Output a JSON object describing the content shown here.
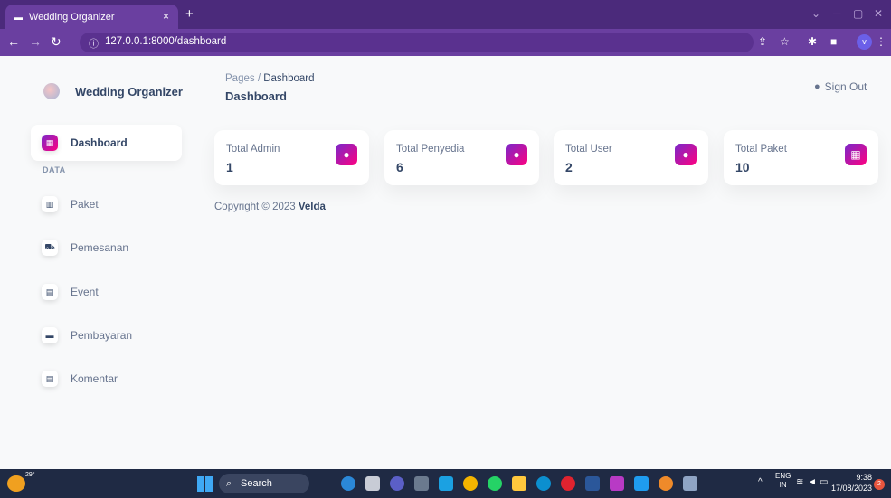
{
  "browser": {
    "tab_title": "Wedding Organizer",
    "tab_close": "×",
    "new_tab": "+",
    "url": "127.0.0.1:8000/dashboard",
    "profile_initial": "v"
  },
  "sidebar": {
    "brand": "Wedding Organizer",
    "active_item": "Dashboard",
    "section": "DATA",
    "items": [
      {
        "label": "Paket",
        "icon": "shop-icon"
      },
      {
        "label": "Pemesanan",
        "icon": "cart-icon"
      },
      {
        "label": "Event",
        "icon": "calendar-icon"
      },
      {
        "label": "Pembayaran",
        "icon": "card-icon"
      },
      {
        "label": "Komentar",
        "icon": "calendar-icon"
      }
    ]
  },
  "header": {
    "breadcrumb_root": "Pages",
    "breadcrumb_sep": "/",
    "breadcrumb_current": "Dashboard",
    "title": "Dashboard",
    "signout": "Sign Out"
  },
  "cards": [
    {
      "label": "Total Admin",
      "value": "1",
      "icon": "user-icon"
    },
    {
      "label": "Total Penyedia",
      "value": "6",
      "icon": "user-icon"
    },
    {
      "label": "Total User",
      "value": "2",
      "icon": "user-icon"
    },
    {
      "label": "Total Paket",
      "value": "10",
      "icon": "building-icon"
    }
  ],
  "footer": {
    "copyright": "Copyright © 2023",
    "author": "Velda"
  },
  "taskbar": {
    "temp": "29°",
    "search": "Search",
    "lang": "ENG",
    "region": "IN",
    "time": "9:38",
    "date": "17/08/2023",
    "notifications": "2"
  },
  "colors": {
    "browser": "#6a3fa0",
    "accent_start": "#7928ca",
    "accent_end": "#ff0080",
    "text": "#344767"
  }
}
